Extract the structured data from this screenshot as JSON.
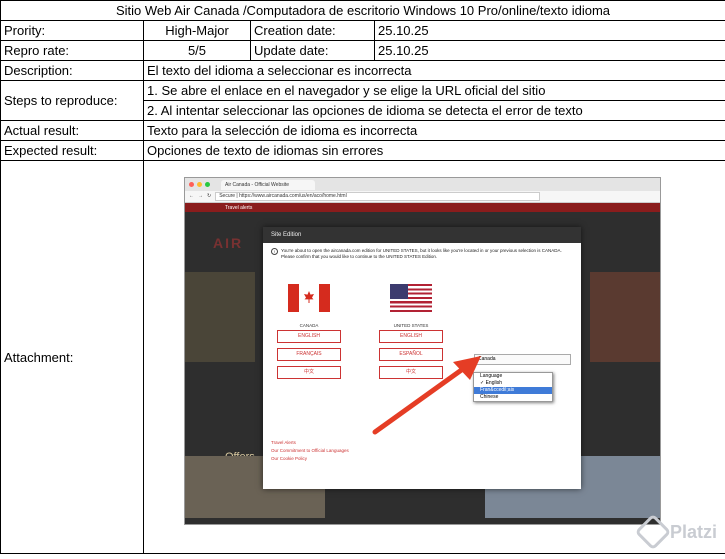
{
  "title": "Sitio Web Air Canada /Computadora de escritorio Windows 10 Pro/online/texto idioma",
  "rows": {
    "priority_label": "Prority:",
    "priority_value": "High-Major",
    "creation_label": "Creation date:",
    "creation_value": "25.10.25",
    "repro_label": "Repro rate:",
    "repro_value": "5/5",
    "update_label": "Update date:",
    "update_value": "25.10.25",
    "description_label": "Description:",
    "description_value": "El texto del idioma a seleccionar es incorrecta",
    "steps_label": "Steps to reproduce:",
    "step1": "1. Se abre el enlace en el navegador y se elige la URL oficial del sitio",
    "step2": "2. Al intentar seleccionar las opciones de idioma se detecta el error de texto",
    "actual_label": "Actual result:",
    "actual_value": "Texto para la selección de idioma es incorrecta",
    "expected_label": "Expected result:",
    "expected_value": "Opciones de texto de idiomas sin errores",
    "attachment_label": "Attachment:"
  },
  "screenshot": {
    "tab_title": "Air Canada - Official Website",
    "url": "Secure | https://www.aircanada.com/us/en/aco/home.html",
    "top_bar_text": "Travel alerts",
    "logo_text": "AIR",
    "offers_text": "Offers",
    "modal_title": "Site Edition",
    "modal_msg_1": "You're about to open the aircanada.com edition for UNITED STATES, but it looks like you're located in or your previous selection is CANADA.",
    "modal_msg_2": "Please confirm that you would like to continue to the UNITED STATES Edition.",
    "canada_caption": "CANADA",
    "us_caption": "UNITED STATES",
    "ca_btn_1": "ENGLISH",
    "ca_btn_2": "FRANÇAIS",
    "ca_btn_3": "中文",
    "us_btn_1": "ENGLISH",
    "us_btn_2": "ESPAÑOL",
    "us_btn_3": "中文",
    "other_editions_label": "OTHER EDITIONS AVAILABLE",
    "other_editions_value": "Canada",
    "dropdown": [
      "Language",
      "✓ English",
      "Fran&ccedil;ais",
      "Chinese"
    ],
    "link_1": "Travel Alerts",
    "link_2": "Our Commitment to Official Languages",
    "link_3": "Our Cookie Policy",
    "watermark": "Platzi"
  },
  "colors": {
    "accent_red": "#d52b1e",
    "highlight_blue": "#3f7bd8",
    "arrow": "#e53d25"
  }
}
